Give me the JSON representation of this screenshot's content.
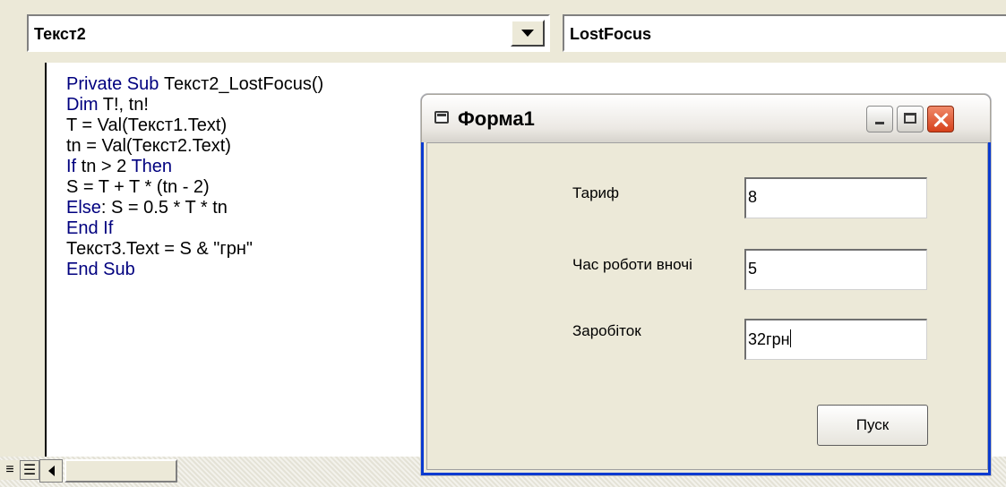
{
  "object_combo": {
    "value": "Текст2"
  },
  "procedure_combo": {
    "value": "LostFocus"
  },
  "code_lines": [
    [
      {
        "t": "Private Sub ",
        "k": true
      },
      {
        "t": "Текст2_LostFocus()",
        "k": false
      }
    ],
    [
      {
        "t": "Dim ",
        "k": true
      },
      {
        "t": "T!, tn!",
        "k": false
      }
    ],
    [
      {
        "t": "T = Val(Текст1.Text)",
        "k": false
      }
    ],
    [
      {
        "t": "tn = Val(Текст2.Text)",
        "k": false
      }
    ],
    [
      {
        "t": "If ",
        "k": true
      },
      {
        "t": "tn > 2 ",
        "k": false
      },
      {
        "t": "Then",
        "k": true
      }
    ],
    [
      {
        "t": "S = T + T * (tn - 2)",
        "k": false
      }
    ],
    [
      {
        "t": "Else",
        "k": true
      },
      {
        "t": ": S = 0.5 * T * tn",
        "k": false
      }
    ],
    [
      {
        "t": "End If",
        "k": true
      }
    ],
    [
      {
        "t": "Текст3.Text = S & \"грн\"",
        "k": false
      }
    ],
    [
      {
        "t": "End Sub",
        "k": true
      }
    ]
  ],
  "form": {
    "title": "Форма1",
    "fields": {
      "tariff_label": "Тариф",
      "tariff_value": "8",
      "night_hours_label": "Час роботи вночі",
      "night_hours_value": "5",
      "earnings_label": "Заробіток",
      "earnings_value": "32грн"
    },
    "run_button": "Пуск"
  },
  "bottom": {
    "procedure_view_icon": "procedure-view-icon",
    "full_module_view_icon": "full-module-view-icon"
  },
  "colors": {
    "keyword": "#00007f",
    "xp_face": "#ece9d8",
    "close_red": "#d6411b"
  }
}
